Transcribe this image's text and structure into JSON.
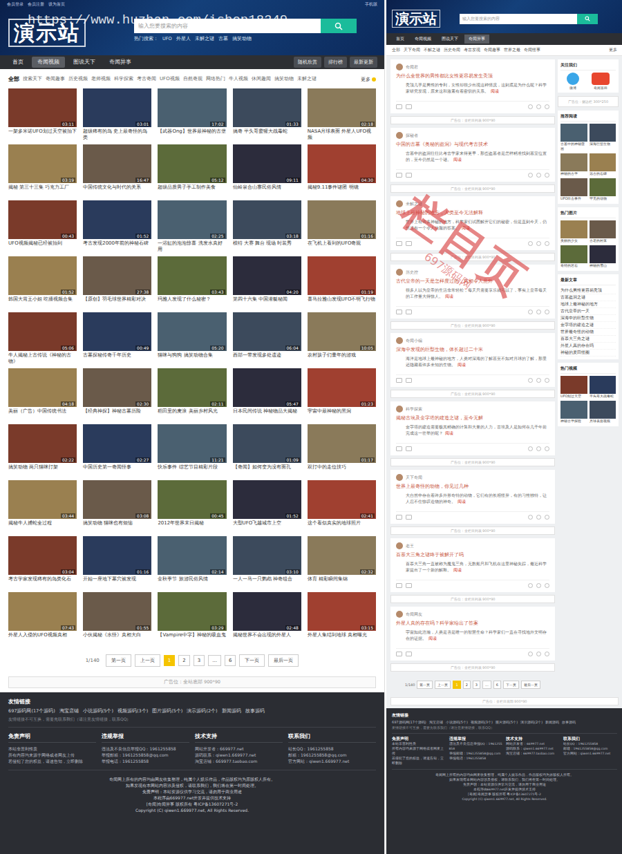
{
  "watermark": "https://www.huzhan.com/ishop18249",
  "list_page": {
    "header": {
      "logo": "演示站",
      "top_links": [
        "会员登录",
        "会员注册",
        "设为首页"
      ],
      "top_right": "手机版",
      "search_placeholder": "输入您要搜索的内容",
      "hot_label": "热门搜索：",
      "hot_words": [
        "UFO",
        "外星人",
        "未解之谜",
        "古墓",
        "搞笑动物"
      ]
    },
    "nav": [
      {
        "label": "首页",
        "selected": false
      },
      {
        "label": "奇闻视频",
        "selected": true
      },
      {
        "label": "图说天下",
        "selected": false
      },
      {
        "label": "奇闻异事",
        "selected": false
      }
    ],
    "nav_buttons": [
      "随机欣赏",
      "排行榜",
      "最新更新"
    ],
    "categories": [
      {
        "label": "全部",
        "selected": true
      },
      {
        "label": "搜索天下",
        "selected": false
      },
      {
        "label": "奇闻趣事",
        "selected": false
      },
      {
        "label": "历史视频",
        "selected": false
      },
      {
        "label": "老师视频",
        "selected": false
      },
      {
        "label": "科学探索",
        "selected": false
      },
      {
        "label": "考古奇闻",
        "selected": false
      },
      {
        "label": "UFO视频",
        "selected": false
      },
      {
        "label": "自然奇观",
        "selected": false
      },
      {
        "label": "网络热门",
        "selected": false
      },
      {
        "label": "牛人视频",
        "selected": false
      },
      {
        "label": "休闲趣闻",
        "selected": false
      },
      {
        "label": "搞笑动物",
        "selected": false
      },
      {
        "label": "未解之谜",
        "selected": false
      }
    ],
    "more": "更多",
    "videos": [
      {
        "title": "一架多米诺UFO划过天空被拍下",
        "duration": "03:11"
      },
      {
        "title": "超级稀有的鸟 史上最奇怪的鸟类",
        "duration": "03:01"
      },
      {
        "title": "【武器Ong】世界最神秘的古堡",
        "duration": "17:02"
      },
      {
        "title": "搞奇 平头哥蜜獾大战毒蛇",
        "duration": "01:33"
      },
      {
        "title": "NASA月球表面 外星人UFO视频",
        "duration": "02:18"
      },
      {
        "title": "揭秘 第三十三集 巧克力工厂",
        "duration": "03:19"
      },
      {
        "title": "中国传统文化与时代的关系",
        "duration": "16:47"
      },
      {
        "title": "超级品质男子手工制作美食",
        "duration": "05:12"
      },
      {
        "title": "仙岭泉合山寨民俗风情",
        "duration": "09:11"
      },
      {
        "title": "揭秘9.11事件谜团 明镜",
        "duration": "04:30"
      },
      {
        "title": "UFO视频揭秘已经被拍到",
        "duration": "00:43"
      },
      {
        "title": "考古发现2000年前的神秘石碑",
        "duration": "01:52"
      },
      {
        "title": "一浴缸的泡泡惊喜 洗发水真好用",
        "duration": "02:25"
      },
      {
        "title": "模特 大赛 舞台 现场 时装秀",
        "duration": "03:18"
      },
      {
        "title": "在飞机上看到的UFO奇观",
        "duration": "01:16"
      },
      {
        "title": "韩国大胃王小姐 吃播视频合集",
        "duration": "01:52"
      },
      {
        "title": "【原创】羽毛球世界精彩对决",
        "duration": "27:38"
      },
      {
        "title": "玛雅人发现了什么秘密？",
        "duration": "03:43"
      },
      {
        "title": "第四十六集 中国潜艇秘闻",
        "duration": "04:20"
      },
      {
        "title": "喜马拉雅山发现UFO不明飞行物",
        "duration": "01:19"
      },
      {
        "title": "牛人揭秘上古传说《神秘的古物》",
        "duration": "05:06"
      },
      {
        "title": "古墓探秘传奇千年历史",
        "duration": "00:49"
      },
      {
        "title": "猫咪与狗狗 搞笑动物合集",
        "duration": "05:20"
      },
      {
        "title": "西部一带发现多处遗迹",
        "duration": "06:04"
      },
      {
        "title": "农村孩子们童年的游戏",
        "duration": "10:05"
      },
      {
        "title": "美丽（广告）中国传统书法",
        "duration": "04:18"
      },
      {
        "title": "【经典神探】神秘古墓历险",
        "duration": "02:30"
      },
      {
        "title": "稻田里的麦浪 美丽乡村风光",
        "duration": "02:11"
      },
      {
        "title": "日本民间传说 神秘物品大揭秘",
        "duration": "05:47"
      },
      {
        "title": "宇宙中最神秘的黑洞",
        "duration": "01:23"
      },
      {
        "title": "搞笑动物 两只猫咪打架",
        "duration": "02:22"
      },
      {
        "title": "中国历史第一奇闻怪事",
        "duration": "02:27"
      },
      {
        "title": "快乐事件 综艺节目精彩片段",
        "duration": "11:21"
      },
      {
        "title": "【奇闻】如何变为没有面孔",
        "duration": "01:09"
      },
      {
        "title": "双打中的走位技巧",
        "duration": "01:17"
      },
      {
        "title": "揭秘牛人捕蛇全过程",
        "duration": "03:44"
      },
      {
        "title": "搞笑动物 猫咪也有烦恼",
        "duration": "03:08"
      },
      {
        "title": "2012年世界末日揭秘",
        "duration": "00:45"
      },
      {
        "title": "大型UFO飞越城市上空",
        "duration": "01:52"
      },
      {
        "title": "这个看似真实的地球照片",
        "duration": "02:41"
      },
      {
        "title": "考古学家发现稀有的鸟类化石",
        "duration": "03:04"
      },
      {
        "title": "开始一座地下墓穴被发现",
        "duration": "01:16"
      },
      {
        "title": "金秋季节 旅游民俗风情",
        "duration": "02:14"
      },
      {
        "title": "一人一马一只鹦鹉 神奇组合",
        "duration": "03:10"
      },
      {
        "title": "体育 精彩瞬间集锦",
        "duration": "02:32"
      },
      {
        "title": "外星人入侵的UFO视频真相",
        "duration": "07:43"
      },
      {
        "title": "小伙揭秘《水怪》真相大白",
        "duration": "01:55"
      },
      {
        "title": "【Vampire中字】神秘的吸血鬼",
        "duration": "03:29"
      },
      {
        "title": "揭秘世界不会出现的外星人",
        "duration": "02:48"
      },
      {
        "title": "外星人集结到地球 真相曝光",
        "duration": "03:15"
      }
    ],
    "pagination": {
      "info": "1/140",
      "first": "第一页",
      "prev": "上一页",
      "pages": [
        {
          "label": "1",
          "selected": true
        },
        {
          "label": "2",
          "selected": false
        },
        {
          "label": "3",
          "selected": false
        },
        {
          "label": "...",
          "selected": false
        },
        {
          "label": "6",
          "selected": false
        }
      ],
      "next": "下一页",
      "last": "最后一页"
    },
    "ad": "广告位：全站底部 900*90",
    "friend_links": {
      "title": "友情链接",
      "links": [
        "697源码网(17个源码)",
        "淘宝店铺",
        "小说源码(5个)",
        "视频源码(3个)",
        "图片源码(5个)",
        "演示源码(2个)",
        "新闻源码",
        "故事源码"
      ],
      "note": "友情链接不可互换，需要先联系我们（请注意友情链接，联系QQ）"
    },
    "footer_columns": [
      {
        "title": "免责声明",
        "lines": [
          "本站非营利性质",
          "所有内容均来源于网络或者网友上传",
          "若侵犯了您的权益，请速告知，立即删除"
        ]
      },
      {
        "title": "违规举报",
        "lines": [
          "违法及不良信息举报QQ：1961255858",
          "举报邮箱：1961255858@qq.com",
          "举报电话：1961255858"
        ]
      },
      {
        "title": "技术支持",
        "lines": [
          "网站开发者：669977.net",
          "源码联系：qiwen1.669977.net",
          "淘宝店铺：669977.taobao.com"
        ]
      },
      {
        "title": "联系我们",
        "lines": [
          "站长QQ：1961255858",
          "邮箱：1961255858@qq.com",
          "官方网站：qiwen1.669977.net"
        ]
      }
    ],
    "copyright": [
      "奇闻网上所有的内容均由网友收集整理，纯属个人娱乐作品，作品版权均为原版权人所有。",
      "如果发现有本网站内容涉及侵权，请联系我们，我们将在第一时间处理。",
      "免责声明：本站资源仅供学习交流，请勿用于商业用途",
      "本程序由669977.net开发并提供技术支持",
      "[奇闻]奇闻异事 版权所有 粤ICP备13607271号-2",
      "Copyright (C) qiwen1.669977.net, All Rights Reserved."
    ]
  },
  "column_page": {
    "nav": [
      {
        "label": "首页",
        "selected": false
      },
      {
        "label": "奇闻视频",
        "selected": false
      },
      {
        "label": "图说天下",
        "selected": false
      },
      {
        "label": "奇闻异事",
        "selected": true
      }
    ],
    "subcategories": [
      "全部",
      "天下奇闻",
      "不解之谜",
      "历史奇闻",
      "考古发现",
      "奇闻趣事",
      "世界之最",
      "奇闻怪事"
    ],
    "more": "更多",
    "read_more": "阅读",
    "list_ad": "广告位：全栏目列表 900*90",
    "posts": [
      {
        "user": "奇闻君",
        "title": "为什么全世界的男性都比女性更容易发生秃顶",
        "excerpt": "秃顶几乎是男性的专利，女性却很少出现这种情况，这到底是为什么呢？科学家研究发现，原来这和激素有着密切的关系。"
      },
      {
        "user": "探秘者",
        "title": "中国的古墓《奥秘的盗洞》与现代考古技术",
        "excerpt": "古墓中的盗洞往往比考古学家来得更早，那些盗墓者是怎样精准找到墓室位置的，至今仍然是一个谜。"
      },
      {
        "user": "未解之谜",
        "title": "地球上最神秘的地方，人类至今无法解释",
        "excerpt": "世界上有许多神秘的地方，科学家们试图解开它们的秘密，但是直到今天，仍然没有一个令人信服的答案。"
      },
      {
        "user": "历史控",
        "title": "古代皇帝的一天是怎样度过的，真相令人意外",
        "excerpt": "很多人以为皇帝的生活非常轻松，每天只需要享乐就可以了，事实上皇帝每天的工作量大得惊人。"
      },
      {
        "user": "奇闻小编",
        "title": "深海中发现的巨型生物，体长超过二十米",
        "excerpt": "海洋是地球上最神秘的地方，人类对深海的了解甚至不如对月球的了解，那里还隐藏着许多未知的生物。"
      },
      {
        "user": "科学探索",
        "title": "揭秘古埃及金字塔的建造之谜，至今无解",
        "excerpt": "金字塔的建造需要极其精确的计算和大量的人力，古埃及人是如何在几千年前完成这一壮举的呢？"
      },
      {
        "user": "天下奇闻",
        "title": "世界上最奇怪的动物，你见过几种",
        "excerpt": "大自然中存在着许多外形奇特的动物，它们有的长相怪异，有的习性独特，让人忍不住惊叹造物的神奇。"
      },
      {
        "user": "老王",
        "title": "百慕大三角之谜终于被解开了吗",
        "excerpt": "百慕大三角一直被称为魔鬼三角，无数船只和飞机在这里神秘失踪，最近科学家提出了一个新的解释。"
      },
      {
        "user": "奇闻网友",
        "title": "外星人真的存在吗？科学家给出了答案",
        "excerpt": "宇宙如此浩瀚，人类是否是唯一的智慧生命？科学家们一直在寻找地外文明存在的证据。"
      }
    ],
    "follow": {
      "title": "关注我们",
      "items": [
        "微博",
        "奇闻百科"
      ]
    },
    "side_ad": "广告位：侧边栏 300*250",
    "recommend": {
      "title": "推荐阅读",
      "items": [
        "古墓中的神秘壁画",
        "深海巨型生物",
        "神秘的古堡",
        "远古的石碑",
        "UFO目击事件",
        "罕见的动物"
      ]
    },
    "hot_pics": {
      "title": "热门图片",
      "items": [
        "美丽的少女",
        "古老的村落",
        "奇特的岩石",
        "神秘的雪山"
      ]
    },
    "latest": {
      "title": "最新文章",
      "items": [
        "为什么男性更容易秃顶",
        "古墓盗洞之谜",
        "地球上最神秘的地方",
        "古代皇帝的一天",
        "深海中的巨型生物",
        "金字塔的建造之谜",
        "世界最奇怪的动物",
        "百慕大三角之谜",
        "外星人真的存在吗",
        "神秘的麦田怪圈"
      ]
    },
    "hot_videos": {
      "title": "热门视频",
      "items": [
        "UFO划过天空",
        "平头哥大战毒蛇",
        "神秘古堡探险",
        "月球表面视频"
      ]
    },
    "ad": "广告位：全栏目底部 900*90",
    "stamp": "栏目页",
    "stamp_sub": "697源码网"
  }
}
